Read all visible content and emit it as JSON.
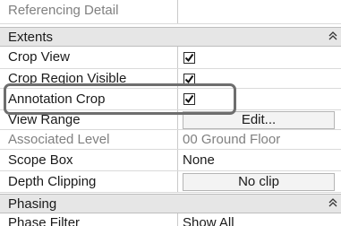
{
  "rows": {
    "referencing_detail": {
      "label": "Referencing Detail"
    },
    "extents_header": {
      "label": "Extents",
      "collapse_glyph": "‸"
    },
    "crop_view": {
      "label": "Crop View",
      "checked": true
    },
    "crop_region_visible": {
      "label": "Crop Region Visible",
      "checked": true
    },
    "annotation_crop": {
      "label": "Annotation Crop",
      "checked": true
    },
    "view_range": {
      "label": "View Range",
      "button": "Edit..."
    },
    "associated_level": {
      "label": "Associated Level",
      "value": "00 Ground Floor"
    },
    "scope_box": {
      "label": "Scope Box",
      "value": "None"
    },
    "depth_clipping": {
      "label": "Depth Clipping",
      "button": "No clip"
    },
    "phasing_header": {
      "label": "Phasing",
      "collapse_glyph": "‸"
    },
    "phase_filter": {
      "label": "Phase Filter",
      "value": "Show All"
    }
  },
  "icons": {
    "checkbox": "checkmark-icon",
    "collapse": "chevron-up-icon"
  },
  "colors": {
    "header_bg": "#e6e6e6",
    "highlight_border": "#6e6e6e",
    "disabled_text": "#808080"
  }
}
